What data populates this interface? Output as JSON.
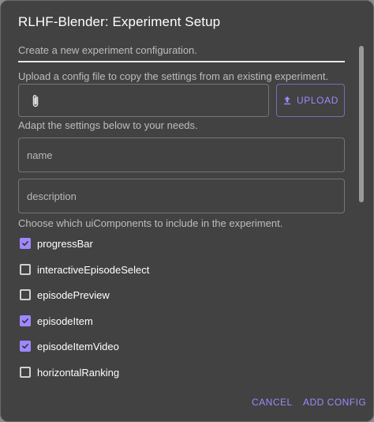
{
  "dialog": {
    "title": "RLHF-Blender: Experiment Setup",
    "subtitle": "Create a new experiment configuration.",
    "upload_hint": "Upload a config file to copy the settings from an existing experiment.",
    "upload_label": "UPLOAD",
    "adapt_hint": "Adapt the settings below to your needs.",
    "name_placeholder": "name",
    "description_placeholder": "description",
    "components_hint": "Choose which uiComponents to include in the experiment.",
    "components": [
      {
        "label": "progressBar",
        "checked": true
      },
      {
        "label": "interactiveEpisodeSelect",
        "checked": false
      },
      {
        "label": "episodePreview",
        "checked": false
      },
      {
        "label": "episodeItem",
        "checked": true
      },
      {
        "label": "episodeItemVideo",
        "checked": true
      },
      {
        "label": "horizontalRanking",
        "checked": false
      }
    ],
    "cancel_label": "CANCEL",
    "add_label": "ADD CONFIG"
  },
  "colors": {
    "accent": "#9f88ff",
    "dialog_bg": "#424242"
  },
  "icons": {
    "attach": "paperclip-icon",
    "upload": "upload-icon",
    "check": "checkmark-icon"
  }
}
